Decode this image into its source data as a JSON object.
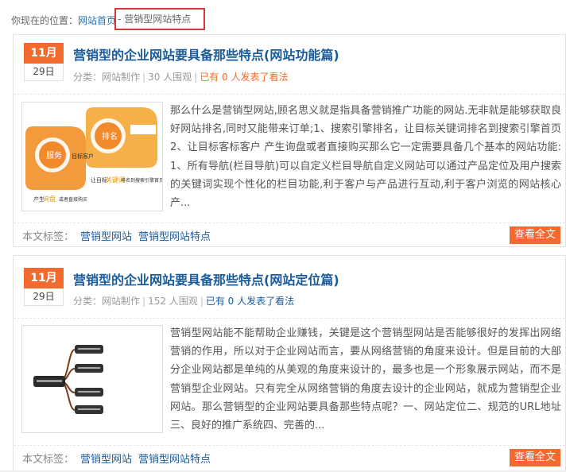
{
  "breadcrumb": {
    "prefix": "你现在的位置：",
    "home": "网站首页",
    "separator": " - ",
    "current": "营销型网站特点"
  },
  "articles": [
    {
      "month": "11月",
      "day": "29日",
      "title": "营销型的企业网站要具备那些特点(网站功能篇)",
      "category_label": "分类：",
      "category": "网站制作",
      "views": "30 人围观",
      "comments": "已有 0 人发表了看法",
      "excerpt": "那么什么是营销型网站,顾名思义就是指具备营销推广功能的网站.无非就是能够获取良好网站排名,同时又能带来订单;1、搜索引擎排名，让目标关键词排名到搜索引擎首页2、让目标客标客户 产生询盘或者直接购买那么它一定需要具备几个基本的网站功能:1、所有导航(栏目导航)可以自定义栏目导航自定义网站可以通过产品定位及用户搜索的关键词实现个性化的栏目功能,利于客户与产品进行互动,利于客户浏览的网站核心产...",
      "tags_label": "本文标签：",
      "tags": [
        "营销型网站",
        "营销型网站特点"
      ],
      "read_more": "查看全文",
      "thumb_texts": [
        "服务",
        "排名",
        "目标客户",
        "让目标",
        "关键词",
        "排名到搜索引擎首页",
        "产生",
        "询盘",
        "或者直接购买"
      ]
    },
    {
      "month": "11月",
      "day": "29日",
      "title": "营销型的企业网站要具备那些特点(网站定位篇)",
      "category_label": "分类：",
      "category": "网站制作",
      "views": "152 人围观",
      "comments": "已有 0 人发表了看法",
      "excerpt": "营销型网站能不能帮助企业赚钱，关键是这个营销型网站是否能够很好的发挥出网络营销的作用，所以对于企业网站而言，要从网络营销的角度来设计。但是目前的大部分企业网站都是单纯的从美观的角度来设计的，最多也是一个形象展示网站，而不是营销型企业网站。只有完全从网络营销的角度去设计的企业网站，就成为营销型企业网站。那么营销型的企业网站要具备那些特点呢？一、网站定位二、规范的URL地址三、良好的推广系统四、完善的...",
      "tags_label": "本文标签：",
      "tags": [
        "营销型网站",
        "营销型网站特点"
      ],
      "read_more": "查看全文"
    }
  ]
}
